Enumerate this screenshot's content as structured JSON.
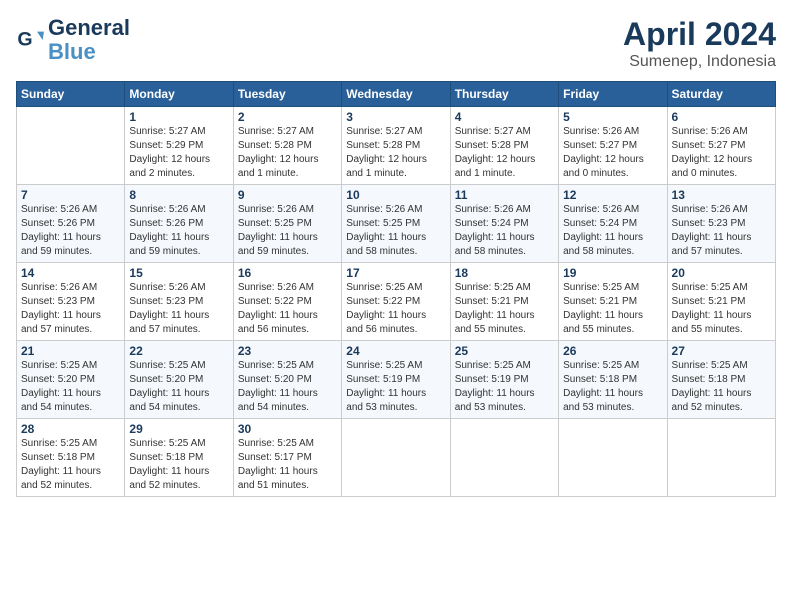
{
  "logo": {
    "line1": "General",
    "line2": "Blue"
  },
  "header": {
    "month": "April 2024",
    "location": "Sumenep, Indonesia"
  },
  "weekdays": [
    "Sunday",
    "Monday",
    "Tuesday",
    "Wednesday",
    "Thursday",
    "Friday",
    "Saturday"
  ],
  "weeks": [
    [
      {
        "day": "",
        "info": ""
      },
      {
        "day": "1",
        "info": "Sunrise: 5:27 AM\nSunset: 5:29 PM\nDaylight: 12 hours\nand 2 minutes."
      },
      {
        "day": "2",
        "info": "Sunrise: 5:27 AM\nSunset: 5:28 PM\nDaylight: 12 hours\nand 1 minute."
      },
      {
        "day": "3",
        "info": "Sunrise: 5:27 AM\nSunset: 5:28 PM\nDaylight: 12 hours\nand 1 minute."
      },
      {
        "day": "4",
        "info": "Sunrise: 5:27 AM\nSunset: 5:28 PM\nDaylight: 12 hours\nand 1 minute."
      },
      {
        "day": "5",
        "info": "Sunrise: 5:26 AM\nSunset: 5:27 PM\nDaylight: 12 hours\nand 0 minutes."
      },
      {
        "day": "6",
        "info": "Sunrise: 5:26 AM\nSunset: 5:27 PM\nDaylight: 12 hours\nand 0 minutes."
      }
    ],
    [
      {
        "day": "7",
        "info": "Sunrise: 5:26 AM\nSunset: 5:26 PM\nDaylight: 11 hours\nand 59 minutes."
      },
      {
        "day": "8",
        "info": "Sunrise: 5:26 AM\nSunset: 5:26 PM\nDaylight: 11 hours\nand 59 minutes."
      },
      {
        "day": "9",
        "info": "Sunrise: 5:26 AM\nSunset: 5:25 PM\nDaylight: 11 hours\nand 59 minutes."
      },
      {
        "day": "10",
        "info": "Sunrise: 5:26 AM\nSunset: 5:25 PM\nDaylight: 11 hours\nand 58 minutes."
      },
      {
        "day": "11",
        "info": "Sunrise: 5:26 AM\nSunset: 5:24 PM\nDaylight: 11 hours\nand 58 minutes."
      },
      {
        "day": "12",
        "info": "Sunrise: 5:26 AM\nSunset: 5:24 PM\nDaylight: 11 hours\nand 58 minutes."
      },
      {
        "day": "13",
        "info": "Sunrise: 5:26 AM\nSunset: 5:23 PM\nDaylight: 11 hours\nand 57 minutes."
      }
    ],
    [
      {
        "day": "14",
        "info": "Sunrise: 5:26 AM\nSunset: 5:23 PM\nDaylight: 11 hours\nand 57 minutes."
      },
      {
        "day": "15",
        "info": "Sunrise: 5:26 AM\nSunset: 5:23 PM\nDaylight: 11 hours\nand 57 minutes."
      },
      {
        "day": "16",
        "info": "Sunrise: 5:26 AM\nSunset: 5:22 PM\nDaylight: 11 hours\nand 56 minutes."
      },
      {
        "day": "17",
        "info": "Sunrise: 5:25 AM\nSunset: 5:22 PM\nDaylight: 11 hours\nand 56 minutes."
      },
      {
        "day": "18",
        "info": "Sunrise: 5:25 AM\nSunset: 5:21 PM\nDaylight: 11 hours\nand 55 minutes."
      },
      {
        "day": "19",
        "info": "Sunrise: 5:25 AM\nSunset: 5:21 PM\nDaylight: 11 hours\nand 55 minutes."
      },
      {
        "day": "20",
        "info": "Sunrise: 5:25 AM\nSunset: 5:21 PM\nDaylight: 11 hours\nand 55 minutes."
      }
    ],
    [
      {
        "day": "21",
        "info": "Sunrise: 5:25 AM\nSunset: 5:20 PM\nDaylight: 11 hours\nand 54 minutes."
      },
      {
        "day": "22",
        "info": "Sunrise: 5:25 AM\nSunset: 5:20 PM\nDaylight: 11 hours\nand 54 minutes."
      },
      {
        "day": "23",
        "info": "Sunrise: 5:25 AM\nSunset: 5:20 PM\nDaylight: 11 hours\nand 54 minutes."
      },
      {
        "day": "24",
        "info": "Sunrise: 5:25 AM\nSunset: 5:19 PM\nDaylight: 11 hours\nand 53 minutes."
      },
      {
        "day": "25",
        "info": "Sunrise: 5:25 AM\nSunset: 5:19 PM\nDaylight: 11 hours\nand 53 minutes."
      },
      {
        "day": "26",
        "info": "Sunrise: 5:25 AM\nSunset: 5:18 PM\nDaylight: 11 hours\nand 53 minutes."
      },
      {
        "day": "27",
        "info": "Sunrise: 5:25 AM\nSunset: 5:18 PM\nDaylight: 11 hours\nand 52 minutes."
      }
    ],
    [
      {
        "day": "28",
        "info": "Sunrise: 5:25 AM\nSunset: 5:18 PM\nDaylight: 11 hours\nand 52 minutes."
      },
      {
        "day": "29",
        "info": "Sunrise: 5:25 AM\nSunset: 5:18 PM\nDaylight: 11 hours\nand 52 minutes."
      },
      {
        "day": "30",
        "info": "Sunrise: 5:25 AM\nSunset: 5:17 PM\nDaylight: 11 hours\nand 51 minutes."
      },
      {
        "day": "",
        "info": ""
      },
      {
        "day": "",
        "info": ""
      },
      {
        "day": "",
        "info": ""
      },
      {
        "day": "",
        "info": ""
      }
    ]
  ]
}
